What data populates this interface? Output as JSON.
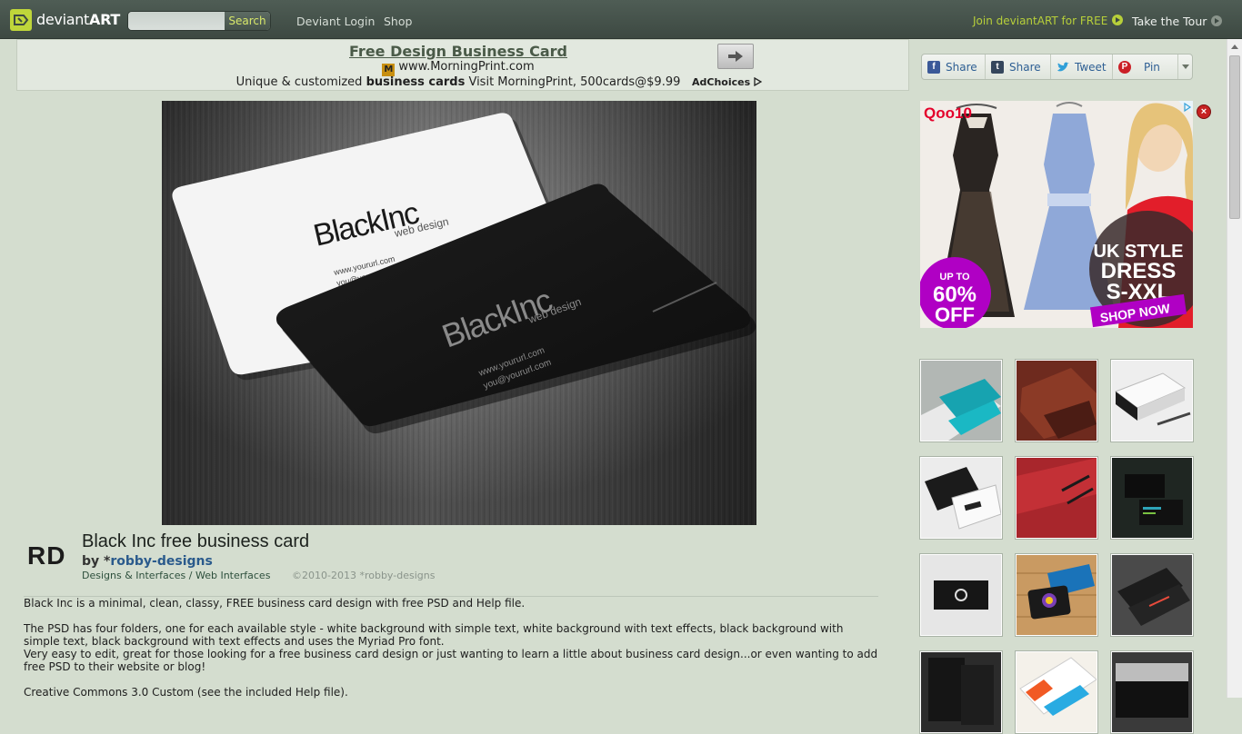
{
  "topbar": {
    "logo_text_plain": "deviant",
    "logo_text_bold": "ART",
    "search_placeholder": "",
    "search_button": "Search",
    "links": [
      "Deviant Login",
      "Shop"
    ],
    "join_link": "Join deviantART for FREE",
    "tour_link": "Take the Tour",
    "accent": "#b7cf3a"
  },
  "ad_banner": {
    "title": "Free Design Business Card",
    "url_icon": "M",
    "url": "www.MorningPrint.com",
    "desc_pre": "Unique & customized ",
    "desc_bold": "business cards",
    "desc_post": " Visit MorningPrint, 500cards@$9.99",
    "adchoices": "AdChoices"
  },
  "artwork": {
    "card_white_brand": "BlackInc",
    "card_white_sub": "web design",
    "card_white_url": "www.yoururl.com",
    "card_white_email": "you@yoururl.com",
    "card_black_brand": "BlackInc",
    "card_black_sub": "web design",
    "card_black_url": "www.yoururl.com",
    "card_black_email": "you@yoururl.com"
  },
  "info": {
    "avatar_initials": "RD",
    "title": "Black Inc free business card",
    "by_prefix": "by *",
    "author": "robby-designs",
    "category_1": "Designs & Interfaces",
    "category_sep": " / ",
    "category_2": "Web Interfaces",
    "copyright": "©2010-2013 *robby-designs"
  },
  "description": {
    "p1": "Black Inc is a minimal, clean, classy, FREE business card design with free PSD and Help file.",
    "p2": "The PSD has four folders, one for each available style - white background with simple text, white background with text effects, black background with simple text, black background with text effects and uses the Myriad Pro font.",
    "p3": "Very easy to edit, great for those looking for a free business card design or just wanting to learn a little about business card design...or even wanting to add free PSD to their website or blog!",
    "p4": "Creative Commons 3.0 Custom (see the included Help file)."
  },
  "share": {
    "facebook": "Share",
    "tumblr": "Share",
    "twitter": "Tweet",
    "pinterest": "Pin"
  },
  "side_ad": {
    "brand": "Qoo10",
    "badge_line1": "UP TO",
    "badge_line2": "60%",
    "badge_line3": "OFF",
    "headline_1": "UK STYLE",
    "headline_2": "DRESS",
    "headline_3": "S-XXL",
    "cta": "SHOP NOW"
  },
  "thumbnails": [
    {
      "name": "teal business card thumbnail"
    },
    {
      "name": "brown business card thumbnail"
    },
    {
      "name": "white stacked cards thumbnail"
    },
    {
      "name": "black and white card thumbnail"
    },
    {
      "name": "red business card thumbnail"
    },
    {
      "name": "dark green card thumbnail"
    },
    {
      "name": "minimal black card thumbnail"
    },
    {
      "name": "wooden table card thumbnail"
    },
    {
      "name": "dark colorful card thumbnail"
    },
    {
      "name": "black textured card thumbnail"
    },
    {
      "name": "colorful white card thumbnail"
    },
    {
      "name": "metal card thumbnail"
    }
  ]
}
